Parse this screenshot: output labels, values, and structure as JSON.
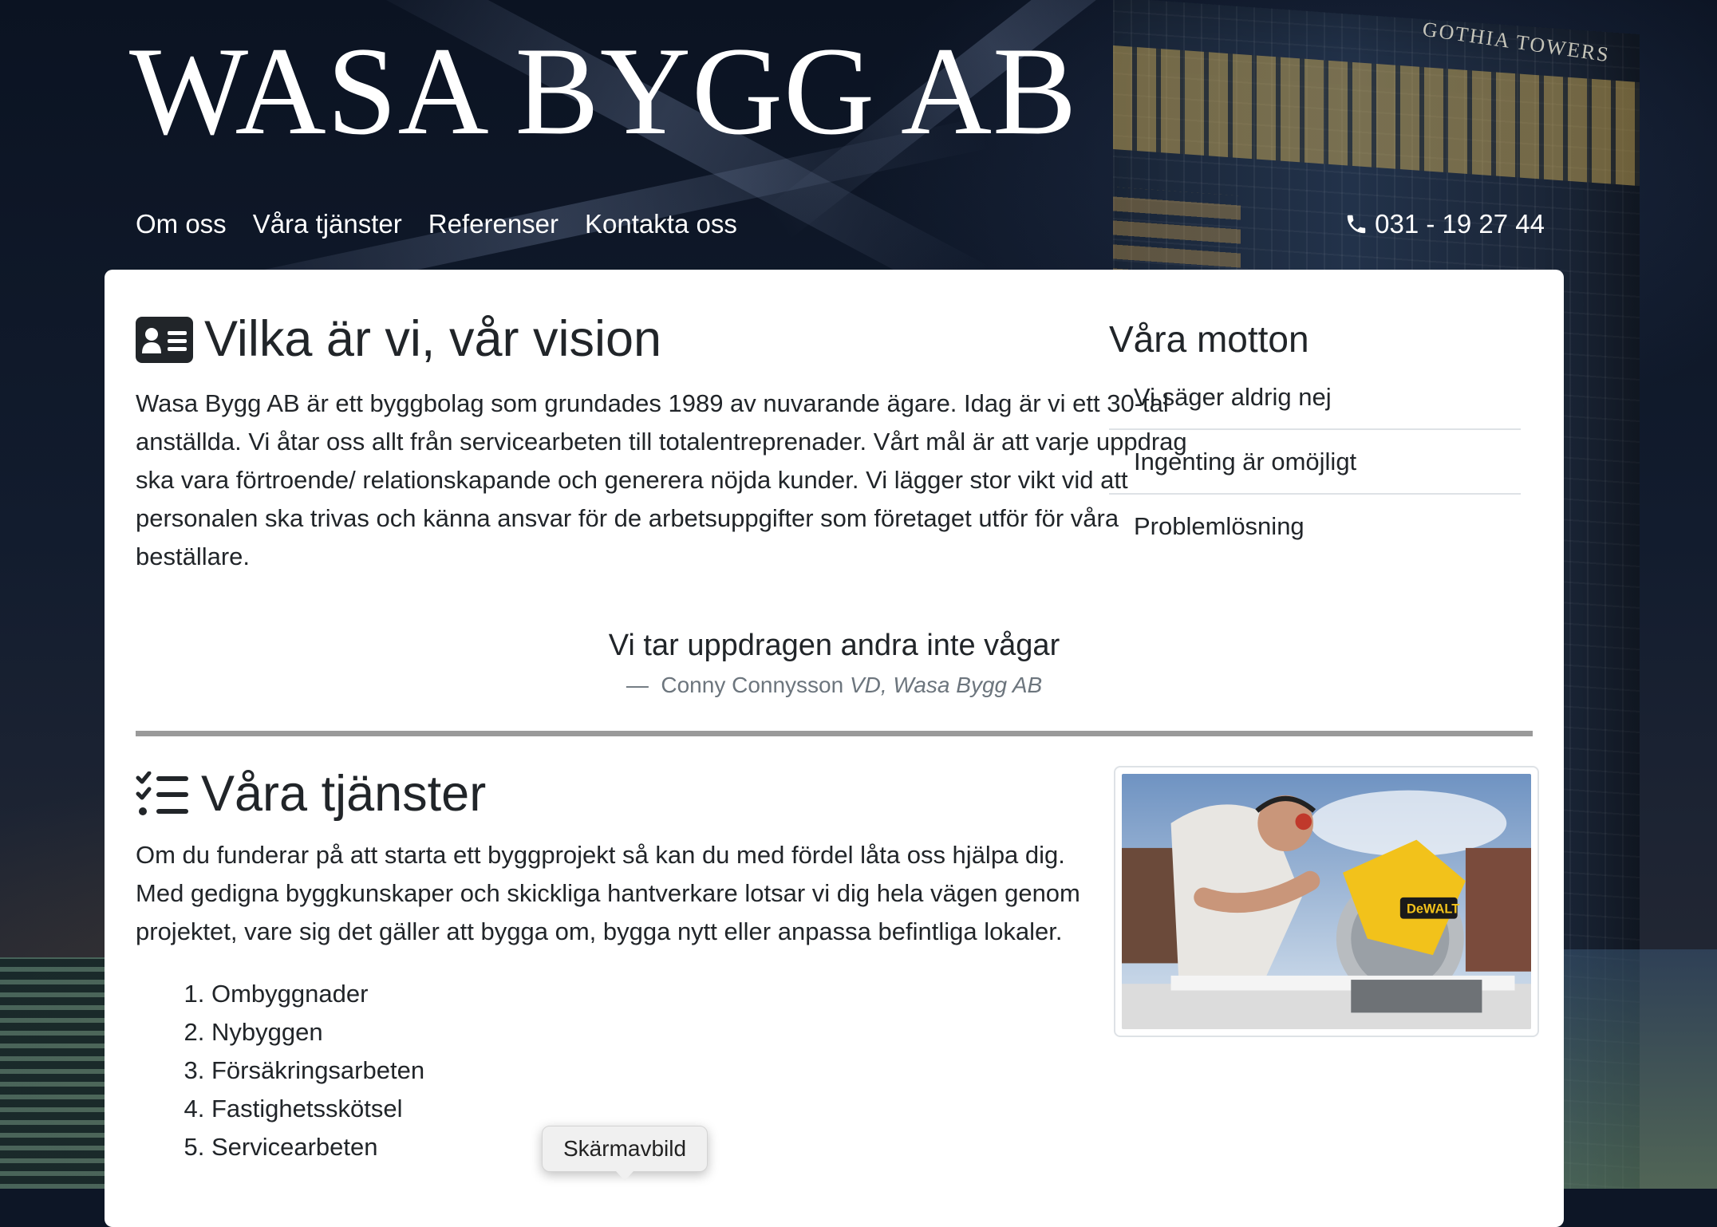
{
  "site": {
    "brand": "WASA BYGG AB",
    "nav": [
      "Om oss",
      "Våra tjänster",
      "Referenser",
      "Kontakta oss"
    ],
    "phone": "031 - 19 27 44",
    "background_sign": "GOTHIA TOWERS"
  },
  "about": {
    "icon": "id-card-icon",
    "title": "Vilka är vi, vår vision",
    "text": "Wasa Bygg AB är ett byggbolag som grundades 1989 av nuvarande ägare. Idag är vi ett 30-tal anställda. Vi åtar oss allt från servicearbeten till totalentreprenader. Vårt mål är att varje uppdrag ska vara förtroende/ relationskapande och generera nöjda kunder. Vi lägger stor vikt vid att personalen ska trivas och känna ansvar för de arbetsuppgifter som företaget utför för våra beställare."
  },
  "mottos": {
    "title": "Våra motton",
    "items": [
      "Vi säger aldrig nej",
      "Ingenting är omöjligt",
      "Problemlösning"
    ]
  },
  "quote": {
    "text": "Vi tar uppdragen andra inte vågar",
    "dash": "—",
    "author": "Conny Connysson",
    "role": "VD, Wasa Bygg AB"
  },
  "services": {
    "icon": "tasks-list-icon",
    "title": "Våra tjänster",
    "text": "Om du funderar på att starta ett byggprojekt så kan du med fördel låta oss hjälpa dig. Med gedigna byggkunskaper och skickliga hantverkare lotsar vi dig hela vägen genom projektet, vare sig det gäller att bygga om, bygga nytt eller anpassa befintliga lokaler.",
    "list": [
      "Ombyggnader",
      "Nybyggen",
      "Försäkringsarbeten",
      "Fastighetsskötsel",
      "Servicearbeten"
    ],
    "photo_brand": "DeWALT"
  },
  "tooltip": "Skärmavbild",
  "colors": {
    "text": "#212529",
    "muted": "#6c757d",
    "divider": "#dee2e6",
    "saw_yellow": "#f2c21b"
  }
}
